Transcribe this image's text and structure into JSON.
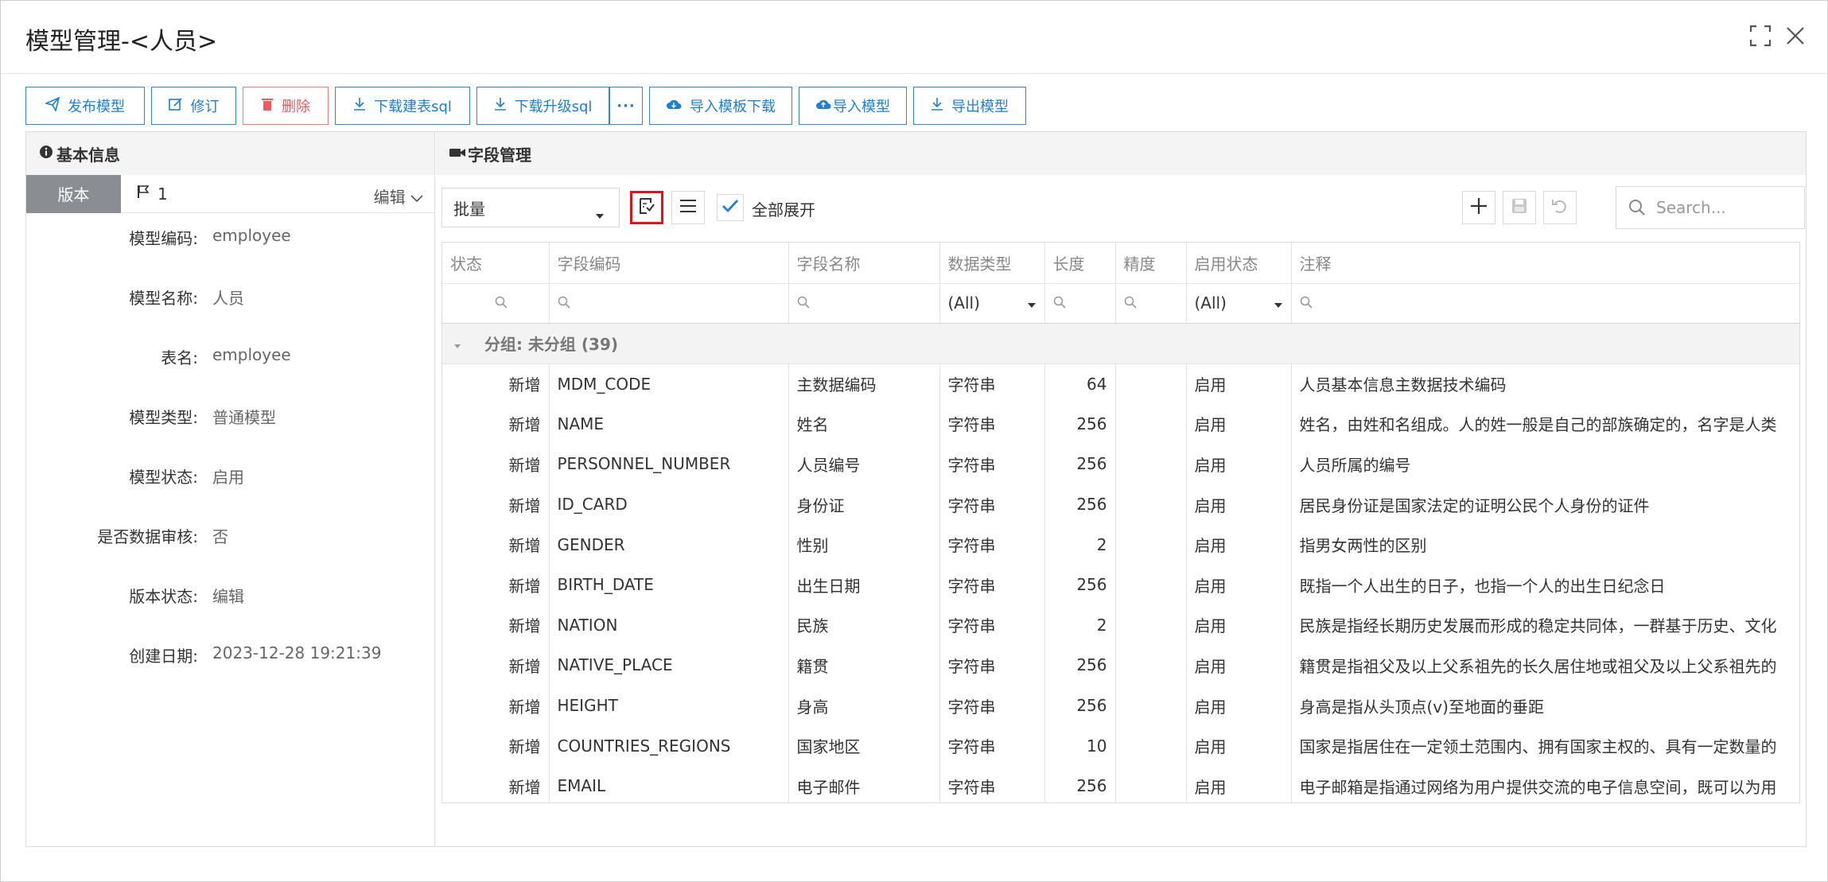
{
  "window": {
    "title": "模型管理-<人员>"
  },
  "toolbar": {
    "buttons": [
      {
        "label": "发布模型",
        "icon": "send-icon"
      },
      {
        "label": "修订",
        "icon": "edit-icon"
      },
      {
        "label": "删除",
        "icon": "trash-icon"
      },
      {
        "label": "下载建表sql",
        "icon": "download-icon"
      },
      {
        "label": "下载升级sql",
        "icon": "download-icon"
      },
      {
        "label": "···",
        "icon": "more-icon"
      },
      {
        "label": "导入模板下载",
        "icon": "cloud-download-icon"
      },
      {
        "label": "导入模型",
        "icon": "cloud-upload-icon"
      },
      {
        "label": "导出模型",
        "icon": "download-icon"
      }
    ]
  },
  "left": {
    "header": "基本信息",
    "version_tab": "版本",
    "version_number": "1",
    "edit_label": "编辑",
    "fields": [
      {
        "label": "模型编码:",
        "value": "employee"
      },
      {
        "label": "模型名称:",
        "value": "人员"
      },
      {
        "label": "表名:",
        "value": "employee"
      },
      {
        "label": "模型类型:",
        "value": "普通模型"
      },
      {
        "label": "模型状态:",
        "value": "启用"
      },
      {
        "label": "是否数据审核:",
        "value": "否"
      },
      {
        "label": "版本状态:",
        "value": "编辑"
      },
      {
        "label": "创建日期:",
        "value": "2023-12-28 19:21:39"
      }
    ]
  },
  "right": {
    "header": "字段管理",
    "batch_select": "批量",
    "expand_all": "全部展开",
    "search_placeholder": "Search...",
    "columns": [
      "状态",
      "字段编码",
      "字段名称",
      "数据类型",
      "长度",
      "精度",
      "启用状态",
      "注释"
    ],
    "filter_all": "(All)",
    "group_label": "分组: 未分组 (39)",
    "rows": [
      [
        "新增",
        "MDM_CODE",
        "主数据编码",
        "字符串",
        "64",
        "",
        "启用",
        "人员基本信息主数据技术编码"
      ],
      [
        "新增",
        "NAME",
        "姓名",
        "字符串",
        "256",
        "",
        "启用",
        "姓名，由姓和名组成。人的姓一般是自己的部族确定的，名字是人类"
      ],
      [
        "新增",
        "PERSONNEL_NUMBER",
        "人员编号",
        "字符串",
        "256",
        "",
        "启用",
        "人员所属的编号"
      ],
      [
        "新增",
        "ID_CARD",
        "身份证",
        "字符串",
        "256",
        "",
        "启用",
        "居民身份证是国家法定的证明公民个人身份的证件"
      ],
      [
        "新增",
        "GENDER",
        "性别",
        "字符串",
        "2",
        "",
        "启用",
        "指男女两性的区别"
      ],
      [
        "新增",
        "BIRTH_DATE",
        "出生日期",
        "字符串",
        "256",
        "",
        "启用",
        "既指一个人出生的日子，也指一个人的出生日纪念日"
      ],
      [
        "新增",
        "NATION",
        "民族",
        "字符串",
        "2",
        "",
        "启用",
        "民族是指经长期历史发展而形成的稳定共同体，一群基于历史、文化"
      ],
      [
        "新增",
        "NATIVE_PLACE",
        "籍贯",
        "字符串",
        "256",
        "",
        "启用",
        "籍贯是指祖父及以上父系祖先的长久居住地或祖父及以上父系祖先的"
      ],
      [
        "新增",
        "HEIGHT",
        "身高",
        "字符串",
        "256",
        "",
        "启用",
        "身高是指从头顶点(v)至地面的垂距"
      ],
      [
        "新增",
        "COUNTRIES_REGIONS",
        "国家地区",
        "字符串",
        "10",
        "",
        "启用",
        "国家是指居住在一定领土范围内、拥有国家主权的、具有一定数量的"
      ],
      [
        "新增",
        "EMAIL",
        "电子邮件",
        "字符串",
        "256",
        "",
        "启用",
        "电子邮箱是指通过网络为用户提供交流的电子信息空间，既可以为用"
      ]
    ]
  },
  "colors": {
    "accent": "#1e7fd4",
    "danger": "#ef5a5a",
    "highlight": "#e3111b",
    "version_tab": "#8a8d91"
  }
}
